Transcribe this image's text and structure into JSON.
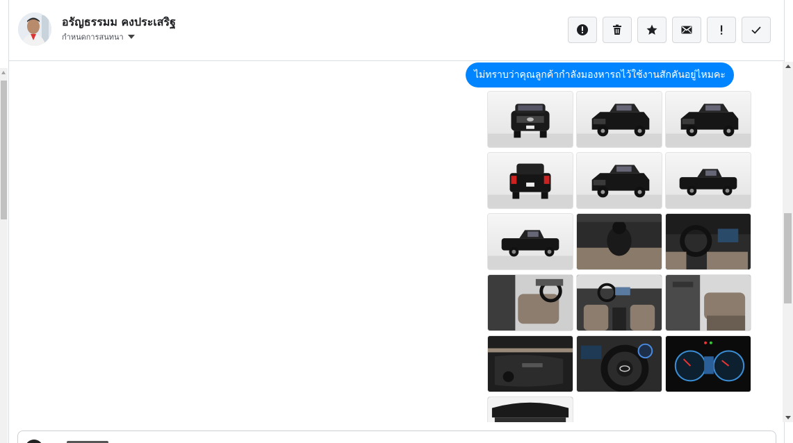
{
  "contact": {
    "name": "อรัญธรรมม คงประเสริฐ",
    "status_label": "กำหนดการสนทนา"
  },
  "toolbar": {
    "buttons": [
      {
        "name": "report-icon"
      },
      {
        "name": "trash-icon"
      },
      {
        "name": "star-icon"
      },
      {
        "name": "mail-icon"
      },
      {
        "name": "exclamation-icon"
      },
      {
        "name": "check-icon"
      }
    ]
  },
  "message": {
    "text": "ไม่ทราบว่าคุณลูกค้ากำลังมองหารถไว้ใช้งานสักคันอยู่ไหมคะ",
    "bubble_color": "#0084ff"
  },
  "gallery": {
    "photos": [
      {
        "type": "exterior",
        "view": "front"
      },
      {
        "type": "exterior",
        "view": "front-three-quarter"
      },
      {
        "type": "exterior",
        "view": "rear-three-quarter"
      },
      {
        "type": "exterior",
        "view": "rear"
      },
      {
        "type": "exterior",
        "view": "rear-three-quarter"
      },
      {
        "type": "exterior",
        "view": "side"
      },
      {
        "type": "exterior",
        "view": "side"
      },
      {
        "type": "interior",
        "view": "gear-shifter"
      },
      {
        "type": "interior",
        "view": "dashboard"
      },
      {
        "type": "interior",
        "view": "front-seats"
      },
      {
        "type": "interior",
        "view": "cabin"
      },
      {
        "type": "interior",
        "view": "rear-seats"
      },
      {
        "type": "interior",
        "view": "door-panel"
      },
      {
        "type": "interior",
        "view": "steering-wheel"
      },
      {
        "type": "interior",
        "view": "gauge-cluster"
      },
      {
        "type": "engine",
        "view": "engine-bay"
      }
    ]
  }
}
